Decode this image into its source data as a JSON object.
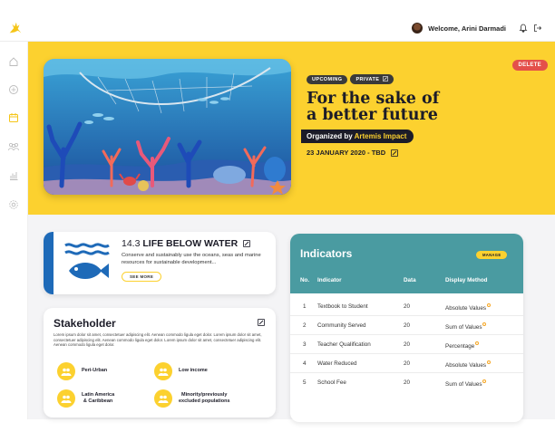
{
  "header": {
    "welcome_text": "Welcome, Arini Darmadi",
    "icons": [
      "logo-deer-icon",
      "bell-icon",
      "logout-icon"
    ]
  },
  "sidebar": {
    "items": [
      {
        "name": "home-icon",
        "active": false
      },
      {
        "name": "explore-icon",
        "active": false
      },
      {
        "name": "calendar-icon",
        "active": true
      },
      {
        "name": "people-icon",
        "active": false
      },
      {
        "name": "chart-icon",
        "active": false
      },
      {
        "name": "settings-icon",
        "active": false
      }
    ]
  },
  "event": {
    "tags": [
      "UPCOMING",
      "PRIVATE"
    ],
    "title_line1": "For the sake of",
    "title_line2": "a better future",
    "organized_by_prefix": "Organized by",
    "organizer": "Artemis Impact",
    "date": "23 JANUARY 2020 - TBD",
    "delete_label": "DELETE"
  },
  "sdg": {
    "number": "14.3",
    "name": "LIFE BELOW WATER",
    "description": "Conserve and sustainably use the oceans, seas and marine resources for sustainable development...",
    "see_more_label": "SEE MORE"
  },
  "stakeholder": {
    "title": "Stakeholder",
    "description": "Lorem ipsum dolor sit amet, consectetuer adipiscing elit. Aenean commodo ligula eget dolor. Lorem ipsum dolor sit amet, consectetuer adipiscing elit. Aenean commodo ligula eget dolor. Lorem ipsum dolor sit amet, consectetuer adipiscing elit. Aenean commodo ligula eget dolor.",
    "items": [
      {
        "label_line1": "Peri-Urban",
        "label_line2": ""
      },
      {
        "label_line1": "Low income",
        "label_line2": ""
      },
      {
        "label_line1": "Latin America",
        "label_line2": "& Caribbean"
      },
      {
        "label_line1": "Minority/previously",
        "label_line2": "excluded populations"
      }
    ]
  },
  "indicators": {
    "title": "Indicators",
    "manage_label": "MANAGE",
    "columns": [
      "No.",
      "Indicator",
      "Data",
      "Display Method"
    ],
    "rows": [
      {
        "no": "1",
        "indicator": "Textbook to Student",
        "data": "20",
        "method": "Absolute Values"
      },
      {
        "no": "2",
        "indicator": "Community Served",
        "data": "20",
        "method": "Sum of Values"
      },
      {
        "no": "3",
        "indicator": "Teacher Qualification",
        "data": "20",
        "method": "Percentage"
      },
      {
        "no": "4",
        "indicator": "Water Reduced",
        "data": "20",
        "method": "Absolute Values"
      },
      {
        "no": "5",
        "indicator": "School Fee",
        "data": "20",
        "method": "Sum of Values"
      }
    ]
  },
  "colors": {
    "accent_yellow": "#fcd12f",
    "teal": "#4a9ba1",
    "sdg_blue": "#1e6ab8",
    "delete_red": "#e4504a"
  }
}
